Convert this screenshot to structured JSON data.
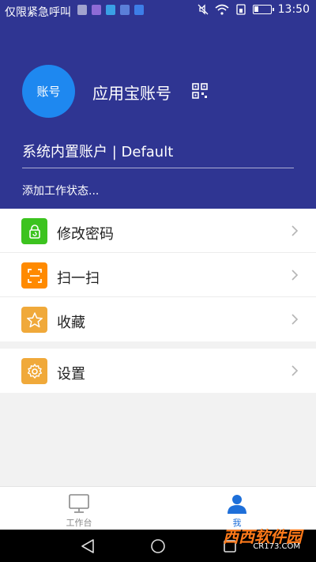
{
  "status_bar": {
    "left_text": "仅限紧急呼叫",
    "time": "13:50"
  },
  "profile": {
    "avatar_text": "账号",
    "account_name": "应用宝账号",
    "system_account": "系统内置账户 | Default",
    "work_status": "添加工作状态..."
  },
  "menu": {
    "items": [
      {
        "label": "修改密码",
        "icon": "lock-reset-icon",
        "color": "#3cc31f"
      },
      {
        "label": "扫一扫",
        "icon": "scan-icon",
        "color": "#ff8a00"
      },
      {
        "label": "收藏",
        "icon": "star-icon",
        "color": "#f0a93a"
      }
    ],
    "settings": {
      "label": "设置",
      "icon": "gear-icon",
      "color": "#f0a93a"
    }
  },
  "bottom_nav": {
    "tabs": [
      {
        "label": "工作台",
        "icon": "monitor-icon",
        "active": false
      },
      {
        "label": "我",
        "icon": "person-icon",
        "active": true
      }
    ]
  },
  "watermark": {
    "brand": "西西软件园",
    "site": "CR173.COM"
  },
  "colors": {
    "header": "#2f3592",
    "avatar": "#1e88f0",
    "active_tab": "#1e6fd9"
  }
}
